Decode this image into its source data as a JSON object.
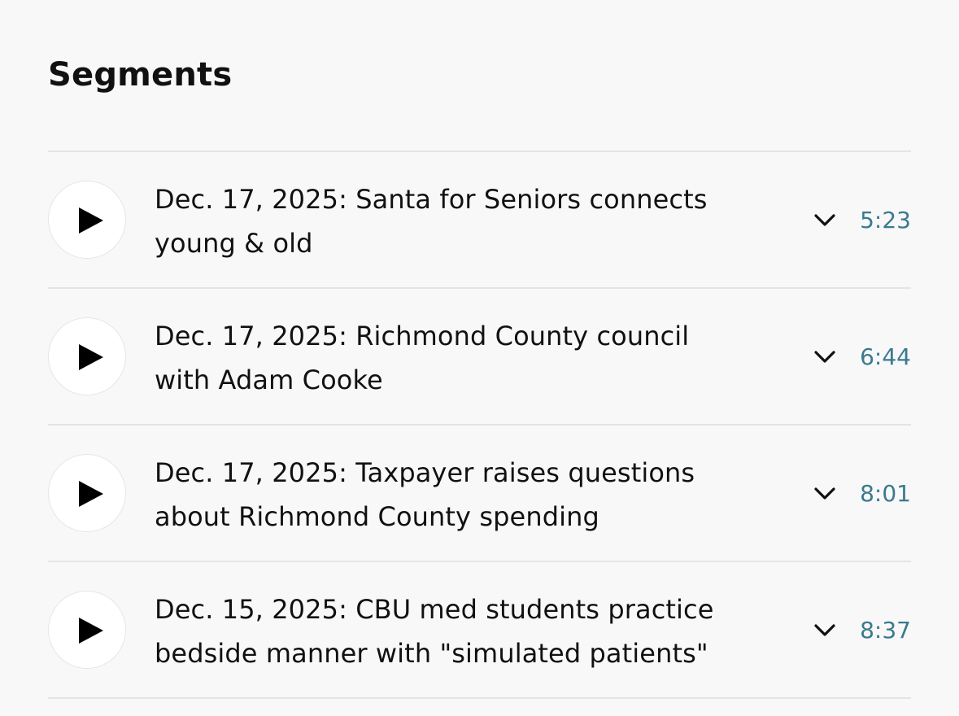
{
  "section": {
    "title": "Segments"
  },
  "colors": {
    "background": "#f8f8f8",
    "divider": "#e4e4e4",
    "duration": "#3b7a8f",
    "text": "#111111"
  },
  "icons": {
    "play": "play-icon",
    "expand": "chevron-down-icon"
  },
  "segments": [
    {
      "title": "Dec. 17, 2025: Santa for Seniors connects young & old",
      "duration": "5:23"
    },
    {
      "title": "Dec. 17, 2025: Richmond County council with Adam Cooke",
      "duration": "6:44"
    },
    {
      "title": "Dec. 17, 2025: Taxpayer raises questions about Richmond County spending",
      "duration": "8:01"
    },
    {
      "title": "Dec. 15, 2025: CBU med students practice bedside manner with \"simulated patients\"",
      "duration": "8:37"
    }
  ]
}
